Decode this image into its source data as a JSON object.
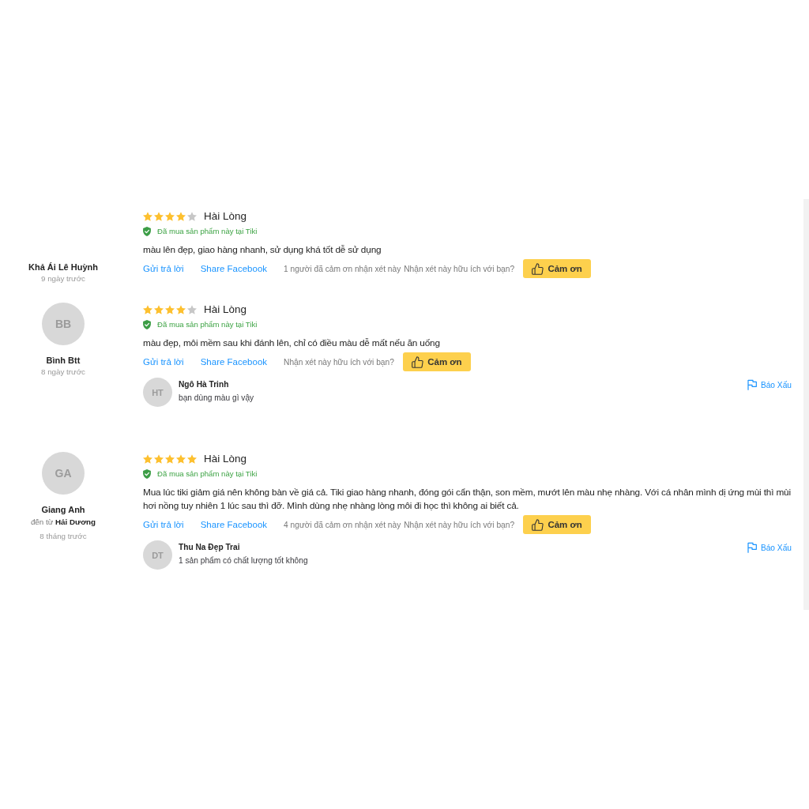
{
  "reviews": [
    {
      "reviewer": {
        "name": "Khả Ái Lê Huỳnh",
        "time": "9 ngày trước"
      },
      "stars": 4,
      "title": "Hài Lòng",
      "verified": "Đã mua sản phẩm này tại Tiki",
      "text": "màu lên đẹp, giao hàng nhanh, sử dụng khá tốt dễ sử dụng",
      "actions": {
        "reply": "Gửi trả lời",
        "share": "Share Facebook",
        "thanks_count": "1 người đã cảm ơn nhận xét này",
        "helpful_prompt": "Nhận xét này hữu ích với bạn?",
        "thanks_button": "Cảm ơn"
      }
    },
    {
      "reviewer": {
        "initials": "BB",
        "name": "Bình Btt",
        "time": "8 ngày trước"
      },
      "stars": 4,
      "title": "Hài Lòng",
      "verified": "Đã mua sản phẩm này tại Tiki",
      "text": "màu đẹp, môi mềm sau khi đánh lên, chỉ có điều màu dễ mất nếu ăn uống",
      "actions": {
        "reply": "Gửi trả lời",
        "share": "Share Facebook",
        "helpful_prompt": "Nhận xét này hữu ích với bạn?",
        "thanks_button": "Cảm ơn"
      },
      "replies": [
        {
          "initials": "HT",
          "name": "Ngô Hà Trinh",
          "text": "bạn dùng màu gì vậy",
          "report": "Báo Xấu"
        }
      ]
    },
    {
      "reviewer": {
        "initials": "GA",
        "name": "Giang Anh",
        "origin": "đến từ **Hải Dương**",
        "time": "8 tháng trước"
      },
      "stars": 5,
      "title": "Hài Lòng",
      "verified": "Đã mua sản phẩm này tại Tiki",
      "text": "Mua lúc tiki giảm giá nên không bàn về giá cả. Tiki giao hàng nhanh, đóng gói cẩn thận, son mềm, mướt lên màu nhẹ nhàng. Với cá nhân mình dị ứng mùi thì mùi hơi nồng tuy nhiên 1 lúc sau thì đỡ. Mình dùng nhẹ nhàng lòng môi đi học thì không ai biết cả.",
      "actions": {
        "reply": "Gửi trả lời",
        "share": "Share Facebook",
        "thanks_count": "4 người đã cảm ơn nhận xét này",
        "helpful_prompt": "Nhận xét này hữu ích với bạn?",
        "thanks_button": "Cảm ơn"
      },
      "replies": [
        {
          "initials": "DT",
          "name": "Thu Na Đẹp Trai",
          "text": "1 sản phẩm có chất lượng tốt không",
          "report": "Báo Xấu"
        }
      ]
    }
  ]
}
